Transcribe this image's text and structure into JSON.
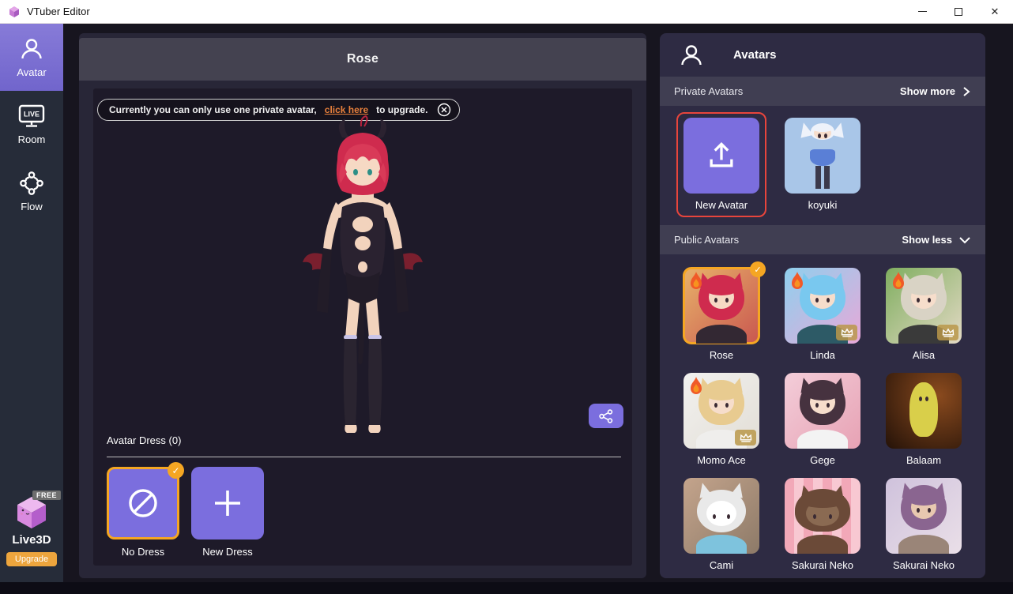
{
  "window": {
    "title": "VTuber Editor"
  },
  "sidebar": {
    "items": [
      {
        "label": "Avatar",
        "active": true
      },
      {
        "label": "Room",
        "active": false
      },
      {
        "label": "Flow",
        "active": false
      }
    ],
    "promo": {
      "name": "Live3D",
      "badge": "FREE",
      "upgrade_label": "Upgrade"
    }
  },
  "main": {
    "title": "Rose",
    "banner": {
      "text_before": "Currently you can only use one private avatar,",
      "link": "click here",
      "text_after": "to upgrade."
    },
    "dress_section": {
      "title": "Avatar Dress (0)",
      "items": [
        {
          "label": "No Dress",
          "selected": true,
          "checked": true
        },
        {
          "label": "New Dress",
          "selected": false,
          "checked": false
        }
      ]
    }
  },
  "right_panel": {
    "title": "Avatars",
    "private_section": {
      "label": "Private Avatars",
      "action": "Show more"
    },
    "public_section": {
      "label": "Public Avatars",
      "action": "Show less"
    },
    "private_avatars": [
      {
        "name": "New Avatar",
        "kind": "upload",
        "highlight": true,
        "palette": {
          "bg": "#7b6ede"
        }
      },
      {
        "name": "koyuki",
        "kind": "figure",
        "palette": {
          "bg": "#a9c6e8",
          "hair": "#eef2fa",
          "skin": "#f6ddcb",
          "body": "#5a7fd6"
        }
      }
    ],
    "public_avatars": [
      {
        "name": "Rose",
        "selected": true,
        "check": true,
        "flame": true,
        "palette": {
          "bg": "linear-gradient(135deg,#e8b36a,#c9564f)",
          "hair": "#cf2b4e",
          "skin": "#f6d9c4",
          "body": "#332833"
        }
      },
      {
        "name": "Linda",
        "flame": true,
        "crown": true,
        "palette": {
          "bg": "linear-gradient(135deg,#8fd0ee,#e8a8d8)",
          "hair": "#79c8ef",
          "skin": "#f6ddcb",
          "body": "#2d5a66"
        }
      },
      {
        "name": "Alisa",
        "flame": true,
        "crown": true,
        "ears": true,
        "palette": {
          "bg": "linear-gradient(135deg,#7fae5f,#e3d9c4)",
          "hair": "#d9d3c5",
          "skin": "#f6ddcb",
          "body": "#3a3a3a"
        }
      },
      {
        "name": "Momo Ace",
        "flame": true,
        "crown": true,
        "ears": true,
        "palette": {
          "bg": "linear-gradient(135deg,#f2f1ef,#e2ded6)",
          "hair": "#e8cb90",
          "skin": "#f6ddcb",
          "body": "#efeeec"
        }
      },
      {
        "name": "Gege",
        "palette": {
          "bg": "linear-gradient(135deg,#f3cdd9,#e7a2b4)",
          "hair": "#46323f",
          "skin": "#f6ddcb",
          "body": "#f3f3f3"
        }
      },
      {
        "name": "Balaam",
        "kind": "blob",
        "palette": {
          "bg": "radial-gradient(circle at 70% 30%,#8a4a1e,#241208)",
          "body": "#d9cf4a",
          "skin": "#d9cf4a"
        }
      },
      {
        "name": "Cami",
        "kind": "cat",
        "ears": true,
        "palette": {
          "bg": "linear-gradient(135deg,#c4a48c,#8d7a68)",
          "hair": "#e9e9e9",
          "skin": "#ffffff",
          "body": "#7ec3dd"
        }
      },
      {
        "name": "Sakurai Neko",
        "kind": "chibi",
        "ears": true,
        "palette": {
          "bg": "repeating-linear-gradient(90deg,#f2a8b8 0 12px,#f8c8d2 12px 24px)",
          "hair": "#6b4a38",
          "skin": "#8a6a52",
          "body": "#6b4a38"
        }
      },
      {
        "name": "Sakurai Neko",
        "ears": true,
        "palette": {
          "bg": "linear-gradient(135deg,#cfc2dc,#eadfe8)",
          "hair": "#8a6590",
          "skin": "#e8c8b0",
          "body": "#9a8578"
        }
      }
    ]
  },
  "colors": {
    "accent_purple": "#7b6ede",
    "selection_orange": "#f5a623",
    "highlight_red": "#e8453c",
    "upgrade_orange": "#eda53d",
    "link_orange": "#e8803c"
  }
}
